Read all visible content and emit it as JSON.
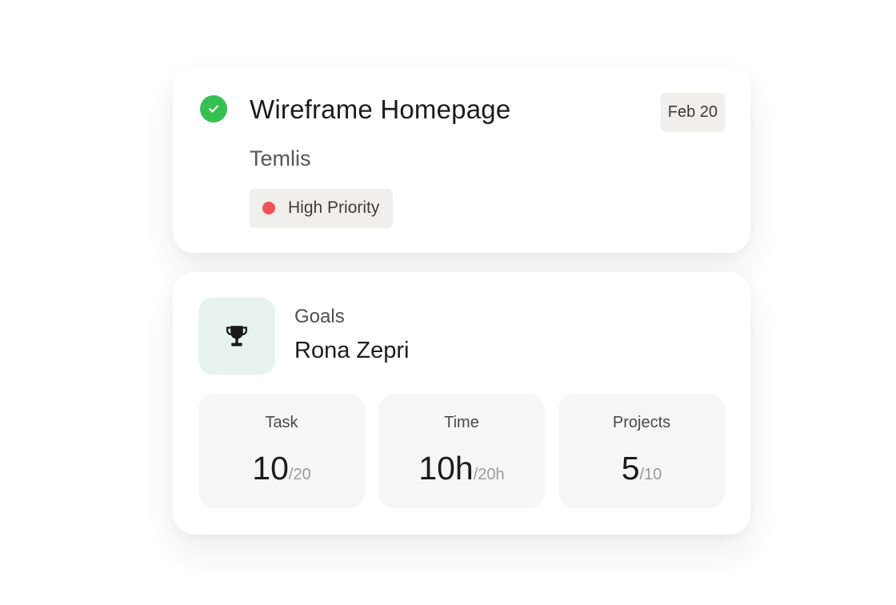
{
  "task": {
    "title": "Wireframe Homepage",
    "subtitle": "Temlis",
    "date": "Feb 20",
    "priority": "High Priority",
    "status_icon": "check-circle-icon",
    "colors": {
      "check": "#34c152",
      "priority_dot": "#f05454"
    }
  },
  "goals": {
    "label": "Goals",
    "name": "Rona Zepri",
    "icon": "trophy-icon",
    "icon_bg": "#e6f3ee",
    "stats": [
      {
        "label": "Task",
        "value": "10",
        "total": "/20"
      },
      {
        "label": "Time",
        "value": "10h",
        "total": "/20h"
      },
      {
        "label": "Projects",
        "value": "5",
        "total": "/10"
      }
    ]
  }
}
